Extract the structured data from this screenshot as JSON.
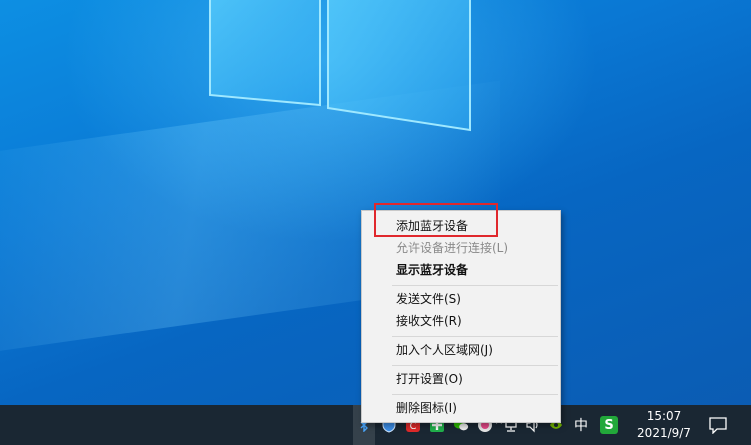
{
  "context_menu": {
    "items": [
      {
        "label": "添加蓝牙设备",
        "state": "enabled"
      },
      {
        "label": "允许设备进行连接(L)",
        "state": "disabled"
      },
      {
        "label": "显示蓝牙设备",
        "state": "default-bold"
      },
      {
        "label": "发送文件(S)",
        "state": "enabled"
      },
      {
        "label": "接收文件(R)",
        "state": "enabled"
      },
      {
        "label": "加入个人区域网(J)",
        "state": "enabled"
      },
      {
        "label": "打开设置(O)",
        "state": "enabled"
      },
      {
        "label": "删除图标(I)",
        "state": "enabled"
      }
    ]
  },
  "taskbar": {
    "tray_icons": [
      "bluetooth-icon",
      "shield-icon",
      "red-app-icon",
      "green-app-icon",
      "wechat-icon",
      "colorful-app-icon",
      "network-icon",
      "volume-icon",
      "nvidia-icon"
    ],
    "ime_label": "中",
    "sogou_label": "S",
    "clock": {
      "time": "15:07",
      "date": "2021/9/7"
    }
  },
  "annotation": {
    "color": "#e0282d"
  }
}
